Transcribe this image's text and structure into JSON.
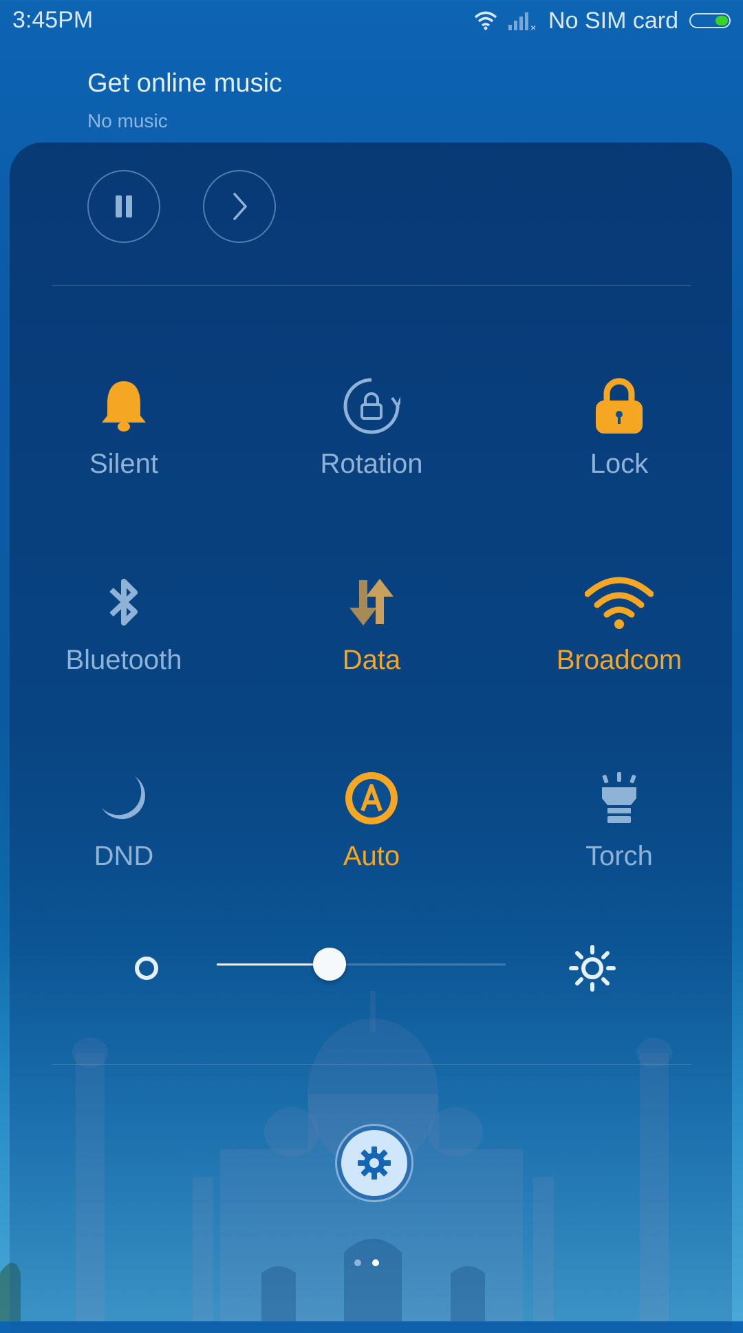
{
  "status_bar": {
    "time": "3:45PM",
    "carrier": "No SIM card",
    "icons": [
      "wifi-icon",
      "signal-no-sim-icon",
      "battery-icon"
    ]
  },
  "music": {
    "title": "Get online music",
    "subtitle": "No music",
    "controls": [
      "pause-icon",
      "next-icon"
    ]
  },
  "toggles": [
    {
      "label": "Silent",
      "icon": "bell-icon",
      "state": "on"
    },
    {
      "label": "Rotation",
      "icon": "rotation-lock-icon",
      "state": "off"
    },
    {
      "label": "Lock",
      "icon": "lock-icon",
      "state": "on"
    },
    {
      "label": "Bluetooth",
      "icon": "bluetooth-icon",
      "state": "off"
    },
    {
      "label": "Data",
      "icon": "data-icon",
      "state": "on"
    },
    {
      "label": "Broadcom",
      "icon": "wifi-icon",
      "state": "on"
    },
    {
      "label": "DND",
      "icon": "moon-icon",
      "state": "off"
    },
    {
      "label": "Auto",
      "icon": "auto-brightness-icon",
      "state": "on"
    },
    {
      "label": "Torch",
      "icon": "torch-icon",
      "state": "off"
    }
  ],
  "brightness": {
    "level": 0.39
  },
  "pager": {
    "pages": 2,
    "current": 2
  },
  "colors": {
    "active": "#f5a623",
    "inactive": "#8fb3d6",
    "accent_battery": "#39d227"
  }
}
